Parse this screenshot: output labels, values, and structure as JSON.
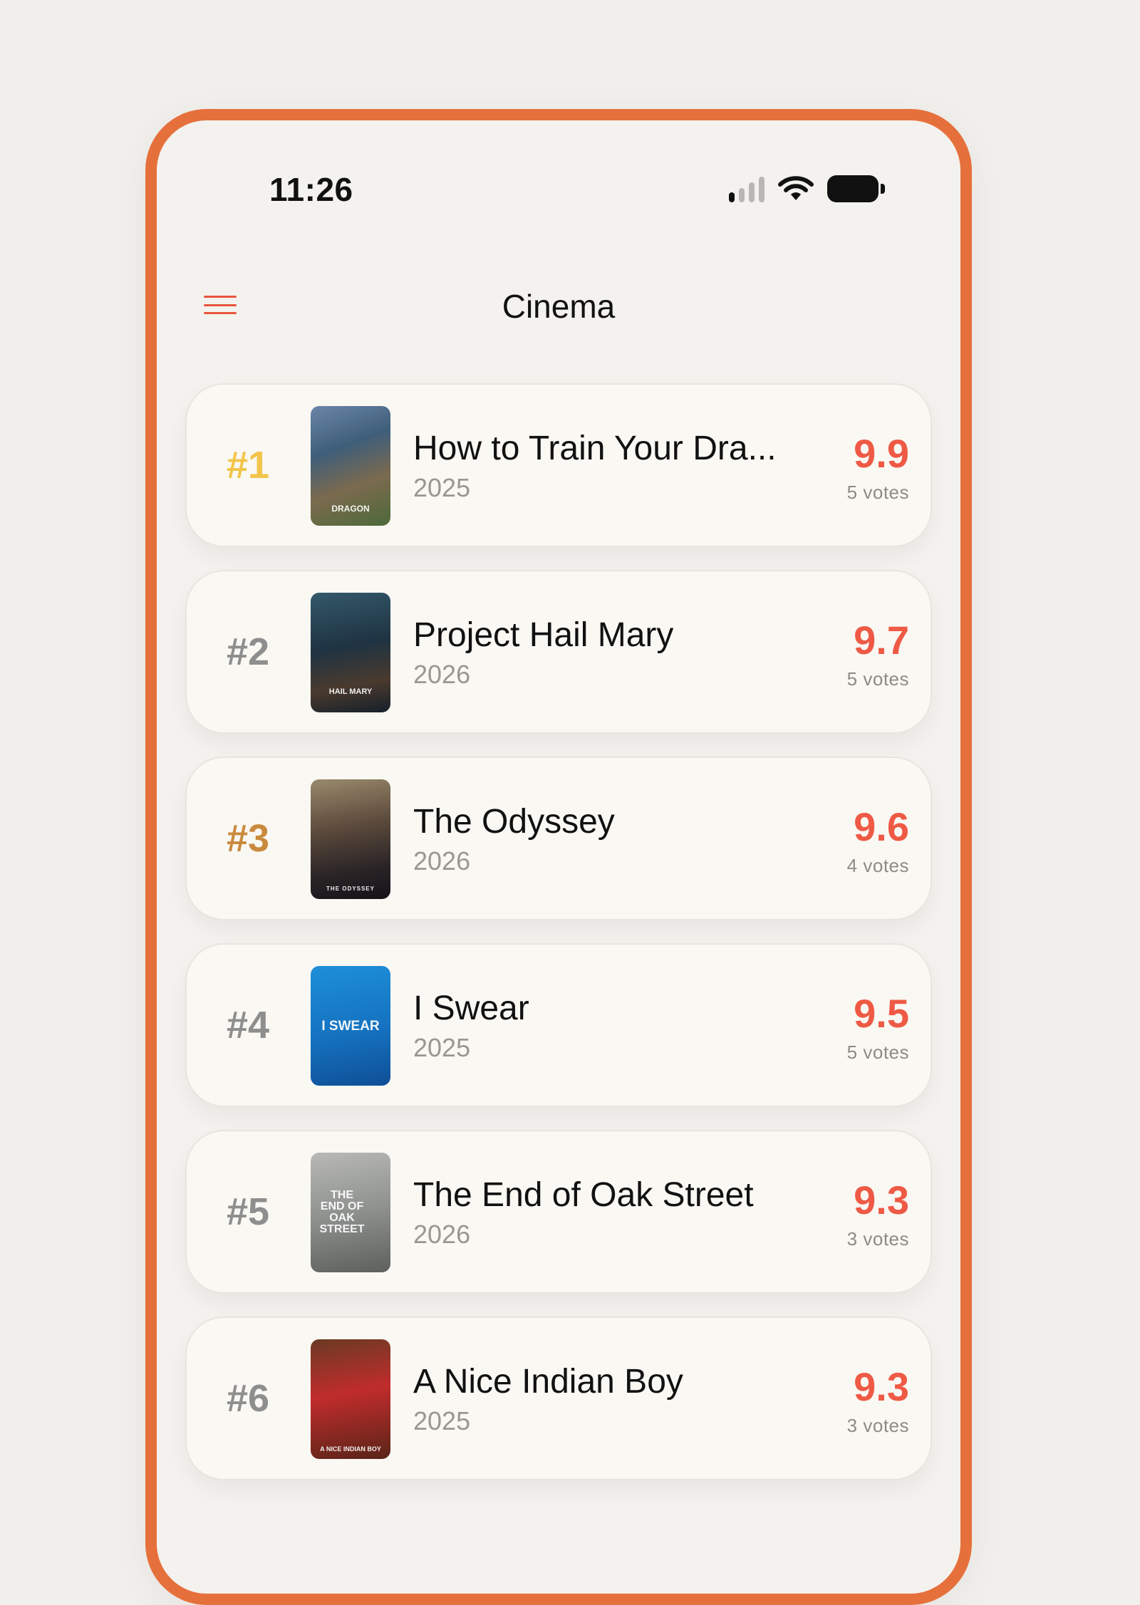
{
  "status_bar": {
    "time": "11:26",
    "icons": [
      "signal-icon",
      "wifi-icon",
      "battery-icon"
    ]
  },
  "header": {
    "title": "Cinema",
    "menu_icon": "hamburger-menu-icon"
  },
  "colors": {
    "frame": "#e6703c",
    "accent": "#ee5a45",
    "rank_gold": "#f2c54a",
    "rank_silver": "#8e8e8e",
    "rank_bronze": "#c98a3e"
  },
  "movies": [
    {
      "rank": "#1",
      "title": "How to Train Your Dra...",
      "year": "2025",
      "score": "9.9",
      "votes": "5 votes",
      "poster_caption": "DRAGON"
    },
    {
      "rank": "#2",
      "title": "Project Hail Mary",
      "year": "2026",
      "score": "9.7",
      "votes": "5 votes",
      "poster_caption": "HAIL MARY"
    },
    {
      "rank": "#3",
      "title": "The Odyssey",
      "year": "2026",
      "score": "9.6",
      "votes": "4 votes",
      "poster_caption": "THE ODYSSEY"
    },
    {
      "rank": "#4",
      "title": "I Swear",
      "year": "2025",
      "score": "9.5",
      "votes": "5 votes",
      "poster_caption": "I SWEAR"
    },
    {
      "rank": "#5",
      "title": "The End of Oak Street",
      "year": "2026",
      "score": "9.3",
      "votes": "3 votes",
      "poster_caption": "THE END OF OAK STREET"
    },
    {
      "rank": "#6",
      "title": "A Nice Indian Boy",
      "year": "2025",
      "score": "9.3",
      "votes": "3 votes",
      "poster_caption": "A NICE INDIAN BOY"
    }
  ]
}
